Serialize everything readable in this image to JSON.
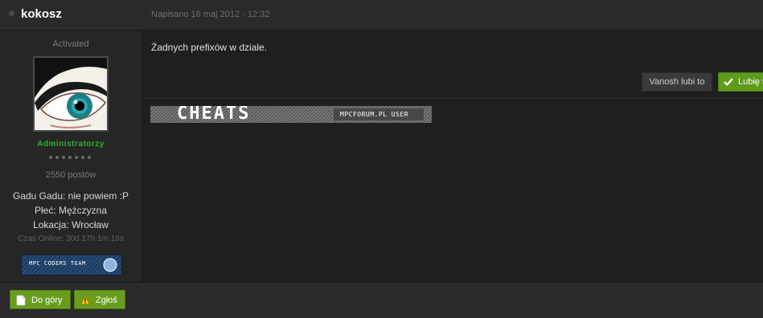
{
  "post": {
    "author": "kokosz",
    "date": "Napisano 16 maj 2012 - 12:32",
    "body": "Żadnych prefixów w dziale."
  },
  "profile": {
    "group_title": "Activated",
    "group_name": "Administratorzy",
    "post_count": "2550 postów",
    "custom_fields": [
      "Gadu Gadu: nie powiem :P",
      "Płeć: Mężczyzna",
      "Lokacja: Wrocław"
    ],
    "online_time": "Czas Online: 30d 17h 1m 16s",
    "team_banner_text": "MPC CODERS TEAM"
  },
  "reputation": {
    "liked_by": "Vanosh lubi to",
    "like_label": "Lubię to"
  },
  "signature": {
    "title": "CHEATS",
    "subtitle": "MPCFORUM.PL USER"
  },
  "actions": {
    "top_label": "Do góry",
    "report_label": "Zgłoś"
  },
  "colors": {
    "accent_green": "#6a9d1f",
    "group_green": "#2db22d"
  },
  "icons": [
    "online-status-icon",
    "check-icon",
    "document-icon",
    "warning-icon"
  ]
}
